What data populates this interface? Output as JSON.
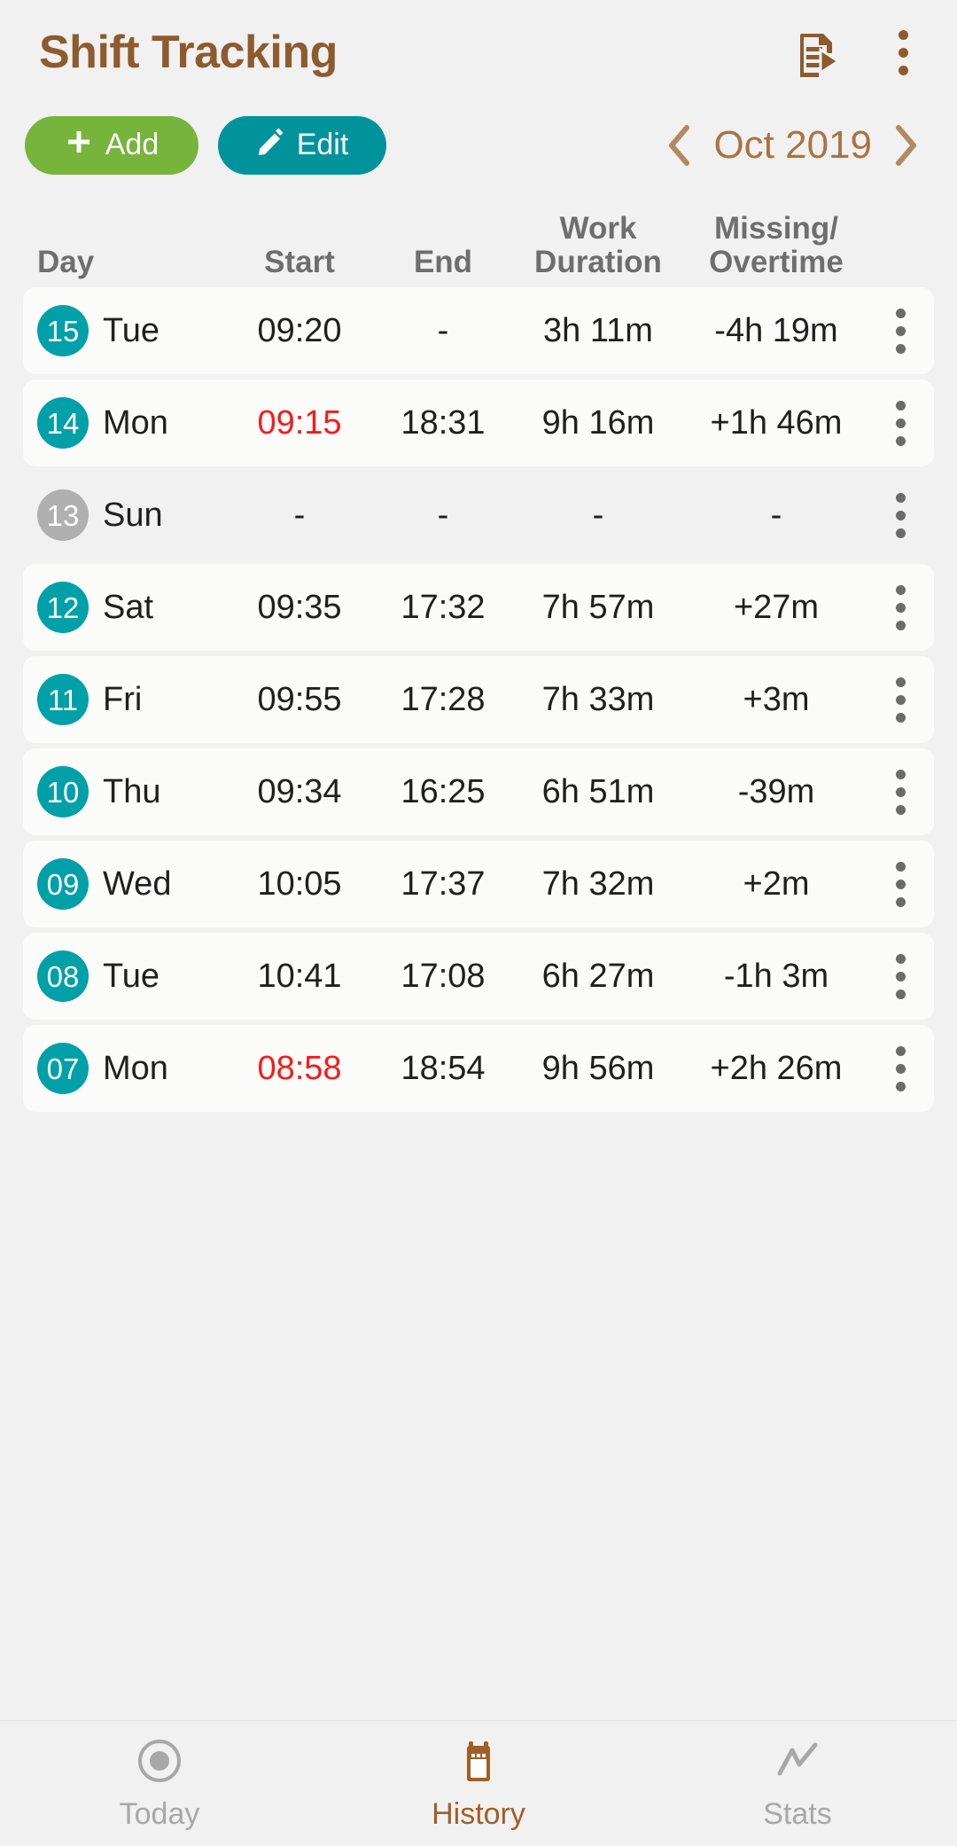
{
  "header": {
    "title": "Shift Tracking",
    "export_icon": "document-export-icon",
    "overflow_icon": "kebab-menu-icon"
  },
  "actions": {
    "add_label": "Add",
    "add_icon": "plus-icon",
    "add_color": "#76b43c",
    "edit_label": "Edit",
    "edit_icon": "pencil-icon",
    "edit_color": "#00939c"
  },
  "month_nav": {
    "prev_icon": "chevron-left-icon",
    "next_icon": "chevron-right-icon",
    "label": "Oct 2019",
    "color": "#a87443"
  },
  "table": {
    "headers": {
      "day": "Day",
      "start": "Start",
      "end": "End",
      "duration_line1": "Work",
      "duration_line2": "Duration",
      "overtime_line1": "Missing/",
      "overtime_line2": "Overtime"
    },
    "row_menu_icon": "kebab-menu-icon",
    "rows": [
      {
        "day": "15",
        "weekday": "Tue",
        "start": "09:20",
        "end": "-",
        "duration": "3h 11m",
        "overtime": "-4h 19m",
        "start_late": false,
        "active": true
      },
      {
        "day": "14",
        "weekday": "Mon",
        "start": "09:15",
        "end": "18:31",
        "duration": "9h 16m",
        "overtime": "+1h 46m",
        "start_late": true,
        "active": true
      },
      {
        "day": "13",
        "weekday": "Sun",
        "start": "-",
        "end": "-",
        "duration": "-",
        "overtime": "-",
        "start_late": false,
        "active": false
      },
      {
        "day": "12",
        "weekday": "Sat",
        "start": "09:35",
        "end": "17:32",
        "duration": "7h 57m",
        "overtime": "+27m",
        "start_late": false,
        "active": true
      },
      {
        "day": "11",
        "weekday": "Fri",
        "start": "09:55",
        "end": "17:28",
        "duration": "7h 33m",
        "overtime": "+3m",
        "start_late": false,
        "active": true
      },
      {
        "day": "10",
        "weekday": "Thu",
        "start": "09:34",
        "end": "16:25",
        "duration": "6h 51m",
        "overtime": "-39m",
        "start_late": false,
        "active": true
      },
      {
        "day": "09",
        "weekday": "Wed",
        "start": "10:05",
        "end": "17:37",
        "duration": "7h 32m",
        "overtime": "+2m",
        "start_late": false,
        "active": true
      },
      {
        "day": "08",
        "weekday": "Tue",
        "start": "10:41",
        "end": "17:08",
        "duration": "6h 27m",
        "overtime": "-1h 3m",
        "start_late": false,
        "active": true
      },
      {
        "day": "07",
        "weekday": "Mon",
        "start": "08:58",
        "end": "18:54",
        "duration": "9h 56m",
        "overtime": "+2h 26m",
        "start_late": true,
        "active": true
      }
    ]
  },
  "bottom_nav": {
    "items": [
      {
        "label": "Today",
        "icon": "record-circle-icon",
        "active": false
      },
      {
        "label": "History",
        "icon": "calendar-icon",
        "active": true
      },
      {
        "label": "Stats",
        "icon": "trend-line-icon",
        "active": false
      }
    ],
    "active_color": "#a05f28",
    "inactive_color": "#a8a8a8"
  },
  "colors": {
    "background": "#f1f1f1",
    "card": "#fbfbfa",
    "brand_brown": "#8d5b2d",
    "badge_active": "#00a0a8",
    "badge_inactive": "#b0b0b0",
    "late_red": "#f21d1d"
  }
}
